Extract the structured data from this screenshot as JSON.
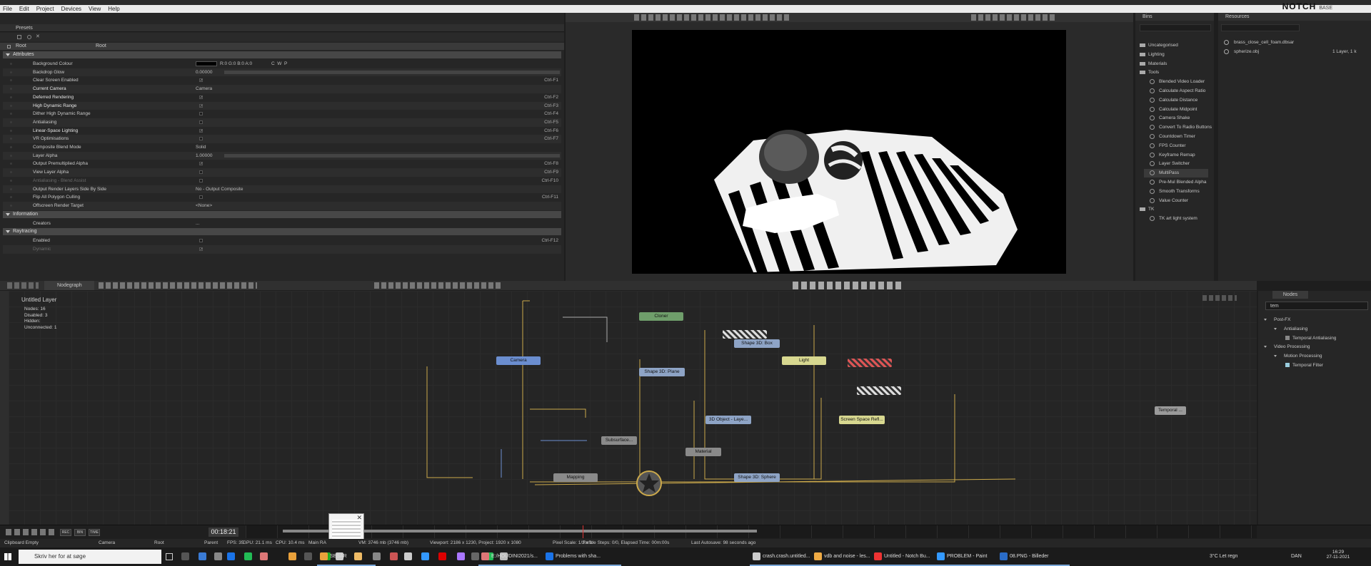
{
  "menu": [
    "File",
    "Edit",
    "Project",
    "Devices",
    "View",
    "Help"
  ],
  "brand": {
    "name": "NOTCH",
    "edition": "BASE"
  },
  "presets": {
    "title": "Presets"
  },
  "root": {
    "col1": "Root",
    "col2": "Root"
  },
  "sections": {
    "attributes": "Attributes",
    "information": "Information",
    "raytracing": "Raytracing"
  },
  "attributes": [
    {
      "name": "Background Colour",
      "value": "R:0 G:0 B:0 A:0",
      "extra": "C  W  P",
      "kb": "",
      "type": "color"
    },
    {
      "name": "Backdrop Glow",
      "value": "0.00000",
      "kb": "",
      "type": "num"
    },
    {
      "name": "Clear Screen Enabled",
      "value": "✓",
      "kb": "Ctrl-F1",
      "type": "check"
    },
    {
      "name": "Current Camera",
      "value": "Camera",
      "kb": "",
      "type": "text",
      "bright": true
    },
    {
      "name": "Deferred Rendering",
      "value": "✓",
      "kb": "Ctrl-F2",
      "type": "check",
      "bright": true
    },
    {
      "name": "High Dynamic Range",
      "value": "✓",
      "kb": "Ctrl-F3",
      "type": "check",
      "bright": true
    },
    {
      "name": "Dither High Dynamic Range",
      "value": "",
      "kb": "Ctrl-F4",
      "type": "check"
    },
    {
      "name": "Antialiasing",
      "value": "",
      "kb": "Ctrl-F5",
      "type": "check"
    },
    {
      "name": "Linear-Space Lighting",
      "value": "✓",
      "kb": "Ctrl-F6",
      "type": "check",
      "bright": true
    },
    {
      "name": "VR Optimisations",
      "value": "",
      "kb": "Ctrl-F7",
      "type": "check"
    },
    {
      "name": "Composite Blend Mode",
      "value": "Solid",
      "kb": "",
      "type": "text"
    },
    {
      "name": "Layer Alpha",
      "value": "1.00000",
      "kb": "",
      "type": "num"
    },
    {
      "name": "Output Premultiplied Alpha",
      "value": "✓",
      "kb": "Ctrl-F8",
      "type": "check"
    },
    {
      "name": "View Layer Alpha",
      "value": "",
      "kb": "Ctrl-F9",
      "type": "check"
    },
    {
      "name": "Antialiasing - Blend Assist",
      "value": "",
      "kb": "Ctrl-F10",
      "type": "check",
      "dim": true
    },
    {
      "name": "Output Render Layers Side By Side",
      "value": "No - Output Composite",
      "kb": "",
      "type": "text"
    },
    {
      "name": "Flip All Polygon Culling",
      "value": "",
      "kb": "Ctrl-F11",
      "type": "check"
    },
    {
      "name": "Offscreen Render Target",
      "value": "<None>",
      "kb": "",
      "type": "text"
    }
  ],
  "information": [
    {
      "name": "Creators",
      "value": "..."
    }
  ],
  "raytracing": [
    {
      "name": "Enabled",
      "value": "",
      "kb": "Ctrl-F12"
    },
    {
      "name": "Dynamic",
      "value": "✓",
      "kb": "",
      "dim": true
    }
  ],
  "bins": {
    "title": "Bins",
    "items": [
      "Uncategorised",
      "Lighting",
      "Materials",
      "Tools"
    ],
    "tools": [
      "Blended Video Loader",
      "Calculate Aspect Ratio",
      "Calculate Distance",
      "Calculate Midpoint",
      "Camera Shake",
      "Convert To Radio Buttons",
      "Countdown Timer",
      "FPS Counter",
      "Keyframe Remap",
      "Layer Switcher",
      "MultiPass",
      "Pre-Mul Blended Alpha",
      "Smooth Transforms",
      "Value Counter"
    ],
    "tk": "TK",
    "tk_items": [
      "TK art light system"
    ]
  },
  "resources": {
    "title": "Resources",
    "items": [
      {
        "name": "brass_close_cell_foam.dbsar",
        "size": ""
      },
      {
        "name": "spherize.obj",
        "size": "1 Layer, 1 k"
      }
    ]
  },
  "nodegraph": {
    "tab": "Nodegraph",
    "layer": "Untitled  Layer",
    "stats": [
      "Nodes:  16",
      "Disabled:  3",
      "Hidden:",
      "Unconnected:  1"
    ]
  },
  "nodes": [
    {
      "label": "Cloner",
      "color": "#6f9e6b"
    },
    {
      "label": "Shape  3D:  Box",
      "color": "#8ea4c6"
    },
    {
      "label": "Camera",
      "color": "#6b8ed0"
    },
    {
      "label": "Light",
      "color": "#d8d890"
    },
    {
      "label": "Shape  3D:  Plane",
      "color": "#8ea4c6"
    },
    {
      "label": "3D  Object  -  Laye...",
      "color": "#8ea4c6"
    },
    {
      "label": "Screen  Space  Refl...",
      "color": "#d8d890"
    },
    {
      "label": "Temporal ...",
      "color": "#9a9a9a"
    },
    {
      "label": "Subsurface...",
      "color": "#8a8a8a"
    },
    {
      "label": "Material",
      "color": "#8a8a8a"
    },
    {
      "label": "Mapping",
      "color": "#8a8a8a"
    },
    {
      "label": "Shape  3D:  Sphere",
      "color": "#8ea4c6"
    }
  ],
  "nodelist": {
    "title": "Nodes",
    "search": "tem",
    "items": [
      "Post-FX",
      "Antialiasing",
      "Temporal Antialiasing",
      "Video Processing",
      "Motion Processing",
      "Temporal Filter"
    ]
  },
  "timeline": {
    "timecode": "00:18:21",
    "buttons": [
      "REC",
      "BIN",
      "TIME"
    ]
  },
  "status": [
    "Clipboard Empty",
    "Camera",
    "Root",
    "Parent",
    "FPS: 35",
    "GPU: 21.1 ms",
    "CPU: 10.4 ms",
    "Main RA",
    "VM: 3746 mb (3746 mb)",
    "Viewport: 2186 x 1230, Project: 1920 x 1080",
    "Pixel Scale: 1/2 x 1/",
    "Refine Steps: 0/0, Elapsed Time: 00m:00s",
    "Last Autosave: 98 seconds ago"
  ],
  "taskbar": {
    "search": "Skriv her for at søge",
    "items": [
      "SBSAR",
      "E:/HOUDINI2021/s...",
      "Problems with sha...",
      "crash.crash.untitled...",
      "vdb and noise - les...",
      "Untitled - Notch Bu...",
      "PROBLEM - Paint",
      "08.PNG - Billeder"
    ],
    "weather": "3°C  Let regn",
    "lang": "DAN",
    "time": "16:29",
    "date": "27-11-2021"
  }
}
